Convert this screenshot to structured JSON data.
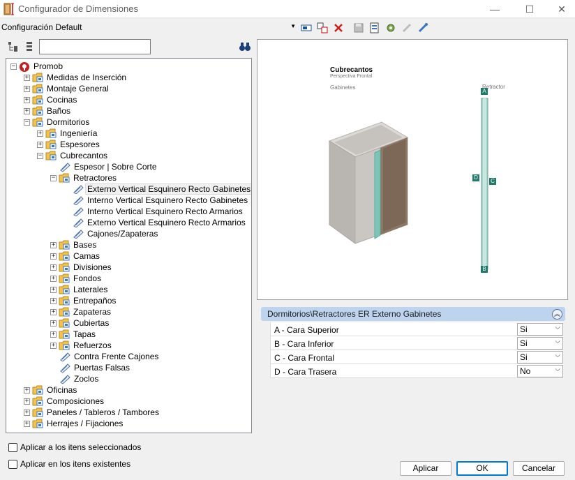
{
  "window": {
    "title": "Configurador de Dimensiones",
    "controls": {
      "minimize": "—",
      "maximize": "☐",
      "close": "✕"
    }
  },
  "toolbar": {
    "config_value": "Configuración Default",
    "icons": [
      "rename-icon",
      "copy-icon",
      "delete-icon",
      "save-icon",
      "export-icon",
      "settings-icon",
      "disconnect-icon",
      "connect-icon"
    ]
  },
  "search": {
    "value": ""
  },
  "tree": {
    "root": "Promob",
    "l1_top": [
      "Medidas de Inserción",
      "Montaje General",
      "Cocinas",
      "Baños"
    ],
    "dormitorios": "Dormitorios",
    "dorm_children_top": [
      "Ingeniería",
      "Espesores"
    ],
    "cubrecantos": "Cubrecantos",
    "espesor": "Espesor | Sobre Corte",
    "retractores": "Retractores",
    "retractor_items": [
      "Externo Vertical Esquinero Recto Gabinetes",
      "Interno Vertical Esquinero Recto Gabinetes",
      "Interno Vertical Esquinero Recto Armarios",
      "Externo Vertical Esquinero Recto Armarios",
      "Cajones/Zapateras"
    ],
    "dorm_children_bottom": [
      "Bases",
      "Camas",
      "Divisiones",
      "Fondos",
      "Laterales",
      "Entrepaños",
      "Zapateras",
      "Cubiertas",
      "Tapas",
      "Refuerzos"
    ],
    "dorm_leaves": [
      "Contra Frente Cajones",
      "Puertas Falsas",
      "Zoclos"
    ],
    "l1_bottom": [
      "Oficinas",
      "Composiciones",
      "Paneles / Tableros / Tambores",
      "Herrajes / Fijaciones"
    ]
  },
  "preview": {
    "title": "Cubrecantos",
    "subtitle": "Perspectiva Frontal",
    "left_label": "Gabinetes",
    "right_label": "Retractor",
    "markers": {
      "a": "A",
      "b": "B",
      "c": "C",
      "d": "D"
    }
  },
  "properties": {
    "header": "Dormitorios\\Retractores ER Externo Gabinetes",
    "rows": [
      {
        "name": "A - Cara Superior",
        "value": "Si"
      },
      {
        "name": "B - Cara Inferior",
        "value": "Si"
      },
      {
        "name": "C - Cara Frontal",
        "value": "Si"
      },
      {
        "name": "D - Cara Trasera",
        "value": "No"
      }
    ]
  },
  "options": {
    "apply_selected": "Aplicar a los itens seleccionados",
    "apply_existing": "Aplicar en los itens existentes"
  },
  "buttons": {
    "apply": "Aplicar",
    "ok": "OK",
    "cancel": "Cancelar"
  },
  "colors": {
    "accent": "#0078d7",
    "marker": "#1f7a6a",
    "header_bg": "#bdd3ee",
    "edge_band": "#7cc4b8"
  }
}
